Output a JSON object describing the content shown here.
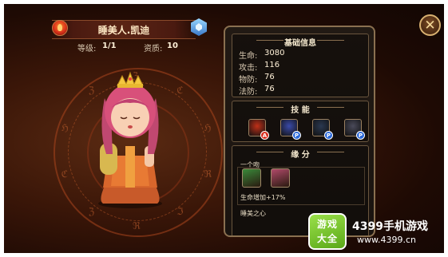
{
  "character": {
    "name": "睡美人.凯迪",
    "level_label": "等级:",
    "level_value": "1/1",
    "aptitude_label": "资质:",
    "aptitude_value": "10"
  },
  "circle_runes": [
    "ℨ",
    "ℭ",
    "ℌ",
    "ℜ",
    "ℑ",
    "ℜ",
    "ℨ",
    "ℭ",
    "ℌ",
    "ℨ"
  ],
  "basic_info": {
    "title": "基础信息",
    "stats": [
      {
        "label": "生命:",
        "value": "3080"
      },
      {
        "label": "攻击:",
        "value": "116"
      },
      {
        "label": "物防:",
        "value": "76"
      },
      {
        "label": "法防:",
        "value": "76"
      }
    ]
  },
  "skills": {
    "title": "技 能",
    "items": [
      {
        "icon": "fire-fist-skill-icon",
        "badge": "A",
        "badge_color": "#d83020",
        "color": "#c03018"
      },
      {
        "icon": "blue-orb-skill-icon",
        "badge": "P",
        "badge_color": "#2a68d8",
        "color": "#3a4aa8"
      },
      {
        "icon": "slash-skill-icon",
        "badge": "P",
        "badge_color": "#2a68d8",
        "color": "#2a3850"
      },
      {
        "icon": "gauntlet-skill-icon",
        "badge": "P",
        "badge_color": "#2a68d8",
        "color": "#4a4a5a"
      }
    ]
  },
  "fate": {
    "title": "缘 分",
    "entry_name": "一个吻",
    "effect": "生命增加+17%",
    "next_name": "睡美之心",
    "icons": [
      {
        "icon": "frog-prince-portrait-icon",
        "color": "#3a8a3a"
      },
      {
        "icon": "sleeping-beauty-portrait-icon",
        "color": "#b04a6a"
      }
    ]
  },
  "watermark": {
    "logo_line1": "游戏",
    "logo_line2": "大全",
    "brand": "4399手机游戏",
    "url": "www.4399.cn"
  }
}
